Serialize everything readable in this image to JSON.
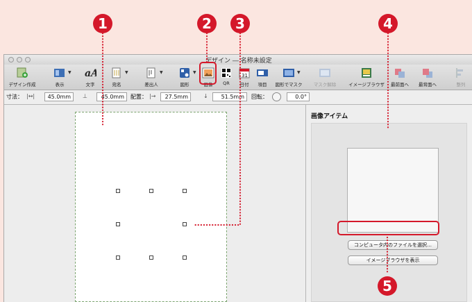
{
  "window": {
    "title": "デザイン ― 名称未設定"
  },
  "toolbar": {
    "items": [
      {
        "label": "デザイン作成"
      },
      {
        "label": "表示"
      },
      {
        "label": "文字"
      },
      {
        "label": "宛名"
      },
      {
        "label": "差出人"
      },
      {
        "label": "図形"
      },
      {
        "label": "画像"
      },
      {
        "label": "QR"
      },
      {
        "label": "日付"
      },
      {
        "label": "項目"
      },
      {
        "label": "図形でマスク"
      },
      {
        "label": "マスク解除"
      },
      {
        "label": "イメージブラウザ"
      },
      {
        "label": "最前面へ"
      },
      {
        "label": "最背面へ"
      },
      {
        "label": "整列"
      }
    ]
  },
  "dimensions": {
    "size_label": "寸法：",
    "width_value": "45.0mm",
    "height_value": "45.0mm",
    "position_label": "配置：",
    "x_value": "27.5mm",
    "y_value": "51.5mm",
    "rotation_label": "回転：",
    "rotation_value": "0.0°"
  },
  "panel": {
    "title": "画像アイテム",
    "choose_file_button": "コンピュータ内のファイルを選択…",
    "show_browser_button": "イメージブラウザを表示"
  },
  "callouts": [
    "1",
    "2",
    "3",
    "4",
    "5"
  ],
  "colors": {
    "accent": "#d4182a",
    "background": "#fbe6e0"
  }
}
